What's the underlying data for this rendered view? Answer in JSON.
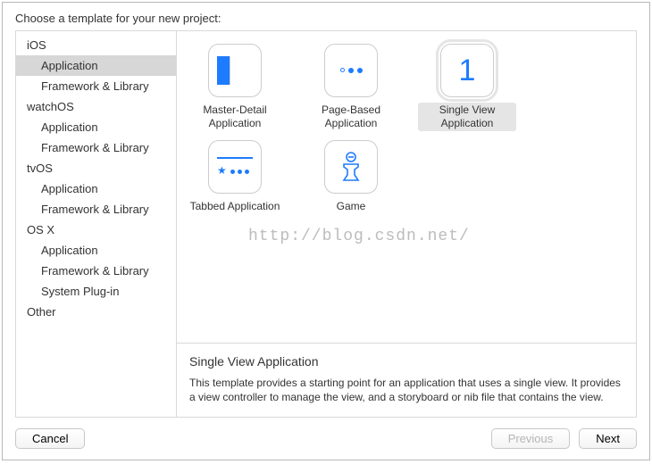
{
  "header": {
    "title": "Choose a template for your new project:"
  },
  "sidebar": {
    "groups": [
      {
        "title": "iOS",
        "items": [
          "Application",
          "Framework & Library"
        ]
      },
      {
        "title": "watchOS",
        "items": [
          "Application",
          "Framework & Library"
        ]
      },
      {
        "title": "tvOS",
        "items": [
          "Application",
          "Framework & Library"
        ]
      },
      {
        "title": "OS X",
        "items": [
          "Application",
          "Framework & Library",
          "System Plug-in"
        ]
      },
      {
        "title": "Other",
        "items": []
      }
    ],
    "selected": "iOS/Application"
  },
  "templates": [
    {
      "id": "master-detail",
      "name": "Master-Detail Application"
    },
    {
      "id": "page-based",
      "name": "Page-Based Application"
    },
    {
      "id": "single-view",
      "name": "Single View Application"
    },
    {
      "id": "tabbed",
      "name": "Tabbed Application"
    },
    {
      "id": "game",
      "name": "Game"
    }
  ],
  "selected_template": "single-view",
  "detail": {
    "title": "Single View Application",
    "description": "This template provides a starting point for an application that uses a single view. It provides a view controller to manage the view, and a storyboard or nib file that contains the view."
  },
  "watermark": "http://blog.csdn.net/",
  "footer": {
    "cancel": "Cancel",
    "previous": "Previous",
    "next": "Next"
  }
}
